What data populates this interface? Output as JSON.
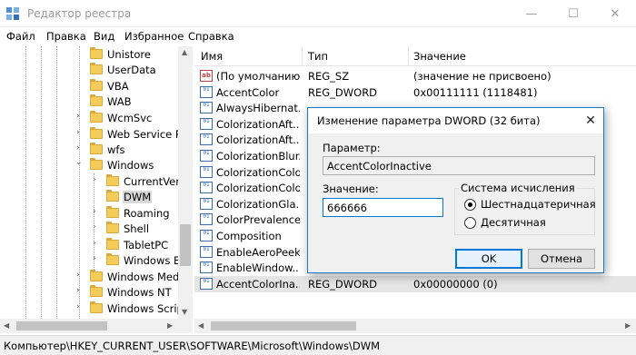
{
  "window": {
    "title": "Редактор реестра",
    "controls": {
      "minimize": "—",
      "maximize": "☐",
      "close": "✕"
    }
  },
  "menu": [
    "Файл",
    "Правка",
    "Вид",
    "Избранное",
    "Справка"
  ],
  "tree": {
    "items": [
      {
        "label": "Unistore"
      },
      {
        "label": "UserData"
      },
      {
        "label": "VBA"
      },
      {
        "label": "WAB"
      },
      {
        "label": "WcmSvc"
      },
      {
        "label": "Web Service Pr"
      },
      {
        "label": "wfs"
      },
      {
        "label": "Windows"
      },
      {
        "label": "CurrentVer"
      },
      {
        "label": "DWM"
      },
      {
        "label": "Roaming"
      },
      {
        "label": "Shell"
      },
      {
        "label": "TabletPC"
      },
      {
        "label": "Windows E"
      },
      {
        "label": "Windows Med"
      },
      {
        "label": "Windows NT"
      },
      {
        "label": "Windows Scrip"
      }
    ],
    "expander_expanded": "⌄",
    "expander_collapsed": "›"
  },
  "list": {
    "columns": [
      "Имя",
      "Тип",
      "Значение"
    ],
    "rows": [
      {
        "icon": "string-value-icon",
        "icon_text": "ab",
        "name": "(По умолчанию)",
        "type": "REG_SZ",
        "value": "(значение не присвоено)"
      },
      {
        "icon": "binary-value-icon",
        "icon_text": "01",
        "name": "AccentColor",
        "type": "REG_DWORD",
        "value": "0x00111111 (1118481)"
      },
      {
        "icon": "binary-value-icon",
        "icon_text": "01",
        "name": "AlwaysHibernat...",
        "type": "",
        "value": ""
      },
      {
        "icon": "binary-value-icon",
        "icon_text": "01",
        "name": "ColorizationAft...",
        "type": "",
        "value": ""
      },
      {
        "icon": "binary-value-icon",
        "icon_text": "01",
        "name": "ColorizationAft...",
        "type": "",
        "value": ""
      },
      {
        "icon": "binary-value-icon",
        "icon_text": "01",
        "name": "ColorizationBlur...",
        "type": "",
        "value": ""
      },
      {
        "icon": "binary-value-icon",
        "icon_text": "01",
        "name": "ColorizationColor",
        "type": "",
        "value": ""
      },
      {
        "icon": "binary-value-icon",
        "icon_text": "01",
        "name": "ColorizationColo...",
        "type": "",
        "value": ""
      },
      {
        "icon": "binary-value-icon",
        "icon_text": "01",
        "name": "ColorizationGla...",
        "type": "",
        "value": ""
      },
      {
        "icon": "binary-value-icon",
        "icon_text": "01",
        "name": "ColorPrevalence",
        "type": "",
        "value": ""
      },
      {
        "icon": "binary-value-icon",
        "icon_text": "01",
        "name": "Composition",
        "type": "",
        "value": ""
      },
      {
        "icon": "binary-value-icon",
        "icon_text": "01",
        "name": "EnableAeroPeek",
        "type": "",
        "value": ""
      },
      {
        "icon": "binary-value-icon",
        "icon_text": "01",
        "name": "EnableWindow...",
        "type": "",
        "value": ""
      },
      {
        "icon": "binary-value-icon",
        "icon_text": "01",
        "name": "AccentColorIna...",
        "type": "REG_DWORD",
        "value": "0x00000000 (0)"
      }
    ]
  },
  "statusbar": {
    "path": "Компьютер\\HKEY_CURRENT_USER\\SOFTWARE\\Microsoft\\Windows\\DWM"
  },
  "dialog": {
    "title": "Изменение параметра DWORD (32 бита)",
    "close": "✕",
    "name_label": "Параметр:",
    "name_value": "AccentColorInactive",
    "value_label": "Значение:",
    "value": "666666",
    "base_group_label": "Система исчисления",
    "base_options": [
      "Шестнадцатеричная",
      "Десятичная"
    ],
    "base_selected": "Шестнадцатеричная",
    "ok_label": "OK",
    "cancel_label": "Отмена"
  },
  "colors": {
    "dialog_border": "#1979ca",
    "focus": "#0078d7",
    "folder": "#f5cc5a"
  }
}
